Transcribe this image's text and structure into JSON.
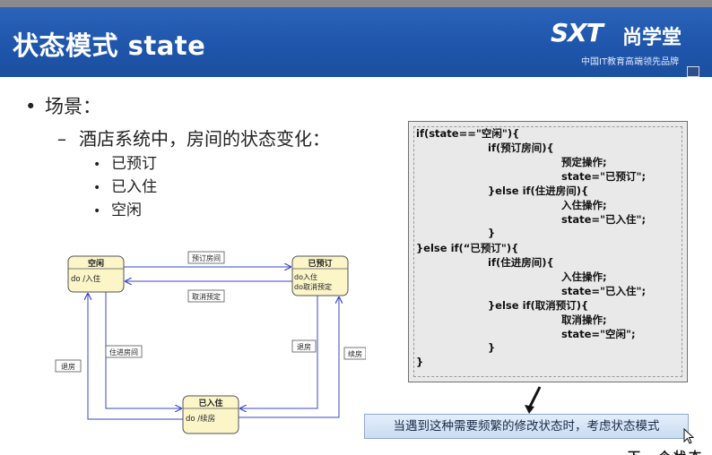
{
  "header": {
    "title": "状态模式 state",
    "logo_mark": "SXT",
    "logo_name": "尚学堂",
    "logo_sub": "中国IT教育高端领先品牌"
  },
  "bullets": {
    "level1": "场景：",
    "level2": "酒店系统中，房间的状态变化：",
    "items": [
      "已预订",
      "已入住",
      "空闲"
    ]
  },
  "diagram": {
    "states": {
      "idle": {
        "name": "空闲",
        "action": "do /入住"
      },
      "booked": {
        "name": "已预订",
        "action1": "do入住",
        "action2": "do取消预定"
      },
      "checked_in": {
        "name": "已入住",
        "action": "do /续房"
      }
    },
    "transitions": {
      "book": "预订房间",
      "cancel": "取消预定",
      "checkin": "住进房间",
      "checkin2": "退房",
      "checkout": "退房",
      "renew": "续房"
    }
  },
  "code": {
    "lines": [
      "if(state==\"空闲\"){",
      "if(预订房间){",
      "预定操作;",
      "state=\"已预订\";",
      "}else if(住进房间){",
      "入住操作;",
      "state=\"已入住\";",
      "}",
      "}else if(“已预订\"){",
      "if(住进房间){",
      "入住操作;",
      "state=\"已入住\";",
      "}else if(取消预订){",
      "取消操作;",
      "state=\"空闲\";",
      "}",
      "}"
    ]
  },
  "callout": {
    "text": "当遇到这种需要频繁的修改状态时，考虑状态模式"
  },
  "corner_fragment": "下一个状态"
}
